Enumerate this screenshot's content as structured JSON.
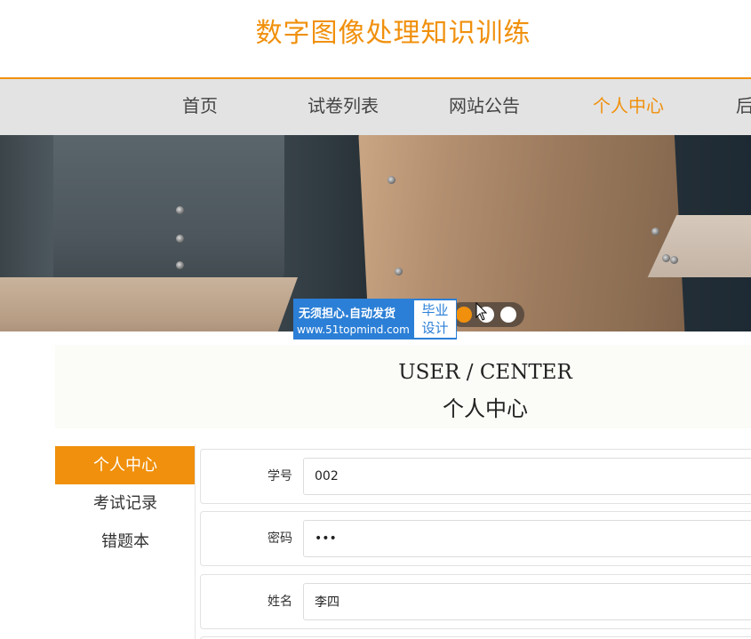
{
  "header": {
    "title": "数字图像处理知识训练"
  },
  "nav": {
    "items": [
      {
        "label": "首页"
      },
      {
        "label": "试卷列表"
      },
      {
        "label": "网站公告"
      },
      {
        "label": "个人中心",
        "active": true
      },
      {
        "label": "后"
      }
    ]
  },
  "banner": {
    "slides": 3,
    "active_slide": 0,
    "watermark": {
      "line1": "无须担心.自动发货",
      "line2": "www.51topmind.com",
      "badge_line1": "毕业",
      "badge_line2": "设计"
    }
  },
  "center": {
    "title_en": "USER / CENTER",
    "title_cn": "个人中心"
  },
  "sidebar": {
    "items": [
      {
        "label": "个人中心",
        "active": true
      },
      {
        "label": "考试记录"
      },
      {
        "label": "错题本"
      }
    ]
  },
  "form": {
    "fields": [
      {
        "label": "学号",
        "value": "002"
      },
      {
        "label": "密码",
        "value": "•••"
      },
      {
        "label": "姓名",
        "value": "李四"
      }
    ]
  },
  "colors": {
    "accent": "#f0900c",
    "nav_bg": "#e3e3e3",
    "watermark_blue": "#2b7fd6"
  }
}
